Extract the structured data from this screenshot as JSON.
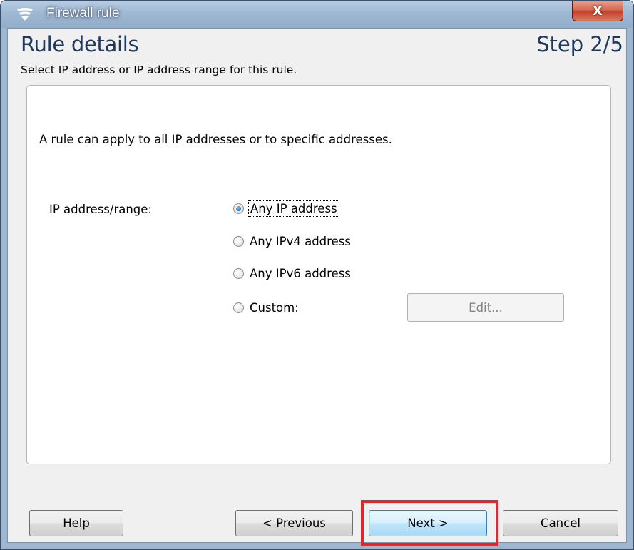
{
  "window": {
    "title": "Firewall rule",
    "close_label": "X"
  },
  "header": {
    "title": "Rule details",
    "step": "Step 2/5",
    "subtitle": "Select IP address or IP address range for this rule."
  },
  "panel": {
    "intro": "A rule can apply to all IP addresses or to specific addresses.",
    "field_label": "IP address/range:",
    "options": [
      {
        "label": "Any IP address",
        "checked": true
      },
      {
        "label": "Any IPv4 address",
        "checked": false
      },
      {
        "label": "Any IPv6 address",
        "checked": false
      },
      {
        "label": "Custom:",
        "checked": false
      }
    ],
    "edit_button": "Edit..."
  },
  "footer": {
    "help": "Help",
    "previous": "< Previous",
    "next": "Next >",
    "cancel": "Cancel"
  },
  "colors": {
    "heading": "#1e395b",
    "highlight": "#e5242c"
  }
}
